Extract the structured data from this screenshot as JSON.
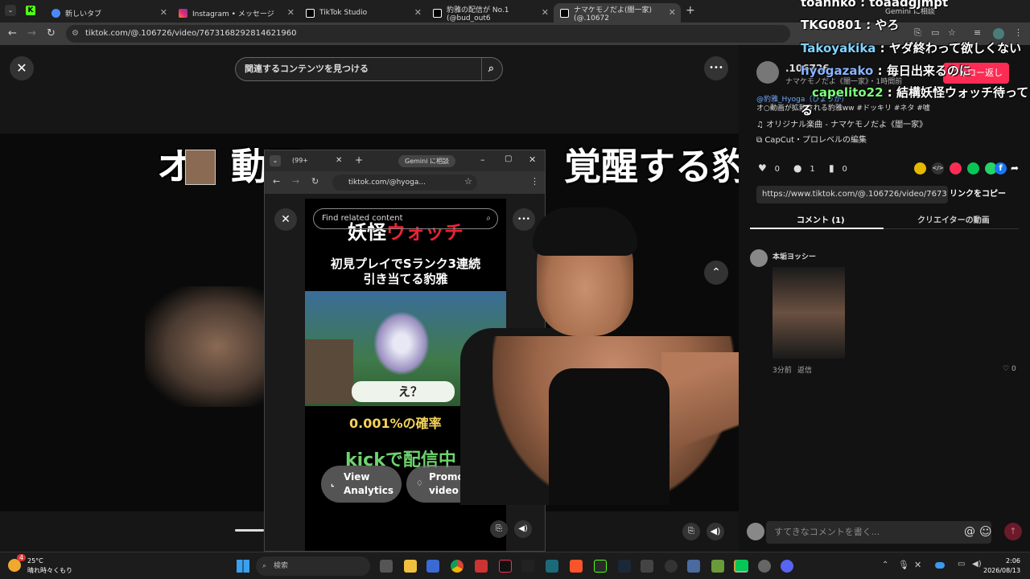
{
  "browser": {
    "tabs": [
      {
        "title": "新しいタブ",
        "favicon_color": "#4a8af4"
      },
      {
        "title": "Instagram • メッセージ",
        "favicon_color": "#d62976"
      },
      {
        "title": "TikTok Studio",
        "favicon_color": "#ffffff"
      },
      {
        "title": "豹雅の配信が No.1 (@bud_out6",
        "favicon_color": "#ffffff"
      },
      {
        "title": "ナマケモノだよ(闇一家) (@.10672",
        "favicon_color": "#ffffff"
      }
    ],
    "kick_tab_label": "K",
    "new_tab_symbol": "+",
    "url": "tiktok.com/@.106726/video/7673168292814621960",
    "gemini_label": "Gemini に相談"
  },
  "tiktok": {
    "search_placeholder": "関連するコンテンツを見つける",
    "headline": "オ　動画　　　　　　　覚醒する豹雅",
    "close_symbol": "✕",
    "more_symbol": "•••",
    "up_symbol": "⌃"
  },
  "inner_window": {
    "tab_count_label": "(99+",
    "gemini_label": "Gemini に相談",
    "url": "tiktok.com/@hyoga...",
    "search_placeholder": "Find related content",
    "video_title_a": "妖怪",
    "video_title_b": "ウォッチ",
    "video_subtitle_1": "初見プレイでSランク3連続",
    "video_subtitle_2": "引き当てる豹雅",
    "speech_bubble": "え？",
    "percent_text": "0.001%の確率",
    "kick_text": "kickで配信中",
    "view_analytics_label": "View Analytics",
    "promote_label": "Promote video"
  },
  "right_panel": {
    "username": ".106726",
    "display_name": "ナマケモノだよ《闇一家》・1時間前",
    "follow_back_label": "フォロー返し",
    "caption_mention": "@豹雅_Hyoga（ひょうが）",
    "caption_text": "オ○動画が拡散される豹雅ww #ドッキリ #ネタ #嘘",
    "music_text": "オリジナル楽曲 - ナマケモノだよ《闇一家》",
    "capcut_text": "CapCut・プロレベルの編集",
    "likes_count": "0",
    "comments_count": "1",
    "saves_count": "0",
    "share_url": "https://www.tiktok.com/@.106726/video/7673168...",
    "copy_link_label": "リンクをコピー",
    "tab_comments": "コメント (1)",
    "tab_creator_videos": "クリエイターの動画",
    "commenter_name": "本垢ヨッシー",
    "comment_time": "3分前",
    "reply_label": "返信",
    "comment_likes": "0",
    "comment_placeholder": "すてきなコメントを書く...",
    "at_symbol": "@",
    "emoji_symbol": "☺"
  },
  "chat_overlay": [
    {
      "user": "toannko",
      "message": "toaadgjmpt",
      "color": "#ffffff"
    },
    {
      "user": "TKG0801",
      "message": "やろ",
      "color": "#ffffff"
    },
    {
      "user": "Takoyakika",
      "message": "ヤダ終わって欲しくない",
      "color": "#7fd4ff"
    },
    {
      "user": "hyogazako",
      "message": "毎日出来るのに",
      "color": "#8ab4ff"
    },
    {
      "user": "capelito22",
      "message": "結構妖怪ウォッチ待ってる",
      "color": "#7dff7d"
    }
  ],
  "taskbar": {
    "weather_temp": "25°C",
    "weather_desc": "晴れ時々くもり",
    "weather_badge": "4",
    "search_label": "検索",
    "time": "2:06",
    "date": "2026/08/13"
  }
}
